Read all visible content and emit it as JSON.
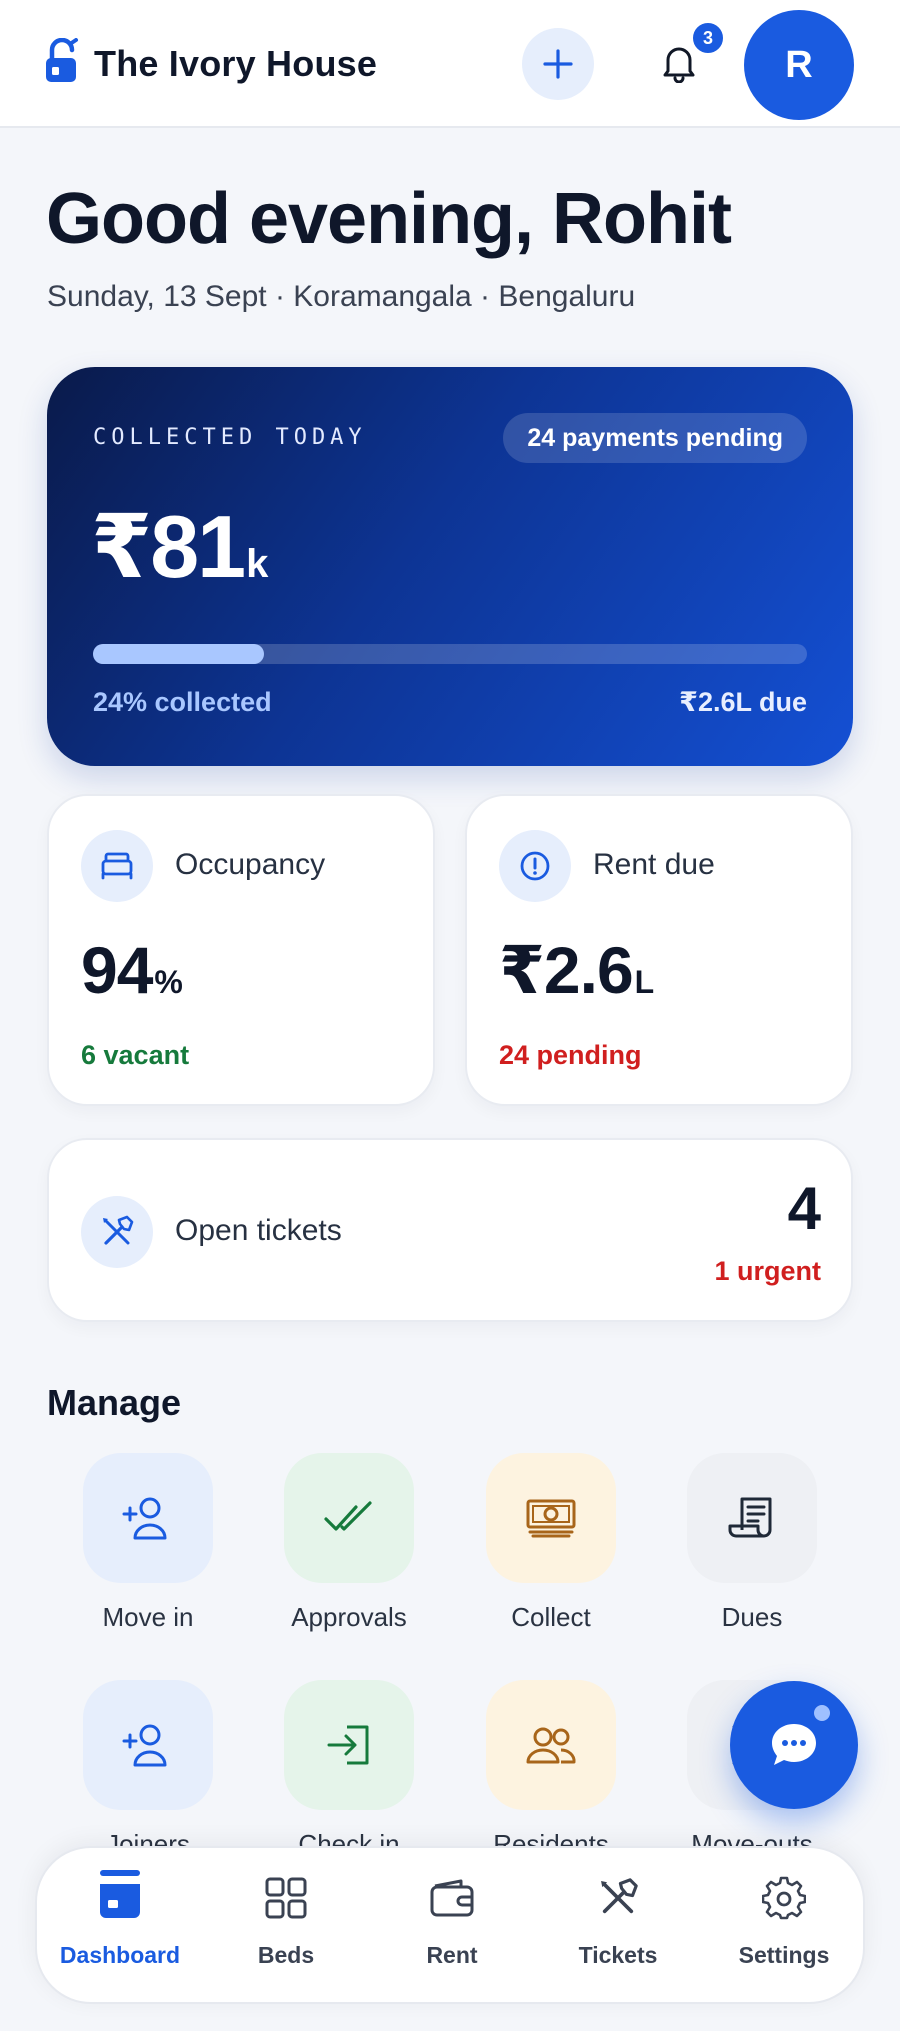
{
  "app": {
    "title": "The Ivory House",
    "notifications_count": "3",
    "avatar_initial": "R"
  },
  "greeting": {
    "title": "Good evening, Rohit",
    "subtitle": "Sunday, 13 Sept · Koramangala · Bengaluru"
  },
  "collected": {
    "label": "COLLECTED TODAY",
    "pending_pill": "24 payments pending",
    "amount": "₹81",
    "amount_unit": "k",
    "progress_fraction": 0.24,
    "percent_text": "24% collected",
    "due_text": "₹2.6L due"
  },
  "occupancy": {
    "title": "Occupancy",
    "value": "94",
    "unit": "%",
    "foot": "6 vacant"
  },
  "rent_due": {
    "title": "Rent due",
    "value": "₹2.6",
    "unit": "L",
    "foot": "24 pending"
  },
  "tickets": {
    "title": "Open tickets",
    "count": "4",
    "urgent": "1 urgent"
  },
  "manage": {
    "title": "Manage",
    "items": [
      {
        "label": "Move in",
        "icon": "user-plus-icon"
      },
      {
        "label": "Approvals",
        "icon": "double-check-icon"
      },
      {
        "label": "Collect",
        "icon": "cash-icon"
      },
      {
        "label": "Dues",
        "icon": "receipt-icon"
      },
      {
        "label": "Joiners",
        "icon": "user-plus-icon"
      },
      {
        "label": "Check in",
        "icon": "sign-in-icon"
      },
      {
        "label": "Residents",
        "icon": "users-icon"
      },
      {
        "label": "Move-outs",
        "icon": "sign-out-icon"
      }
    ]
  },
  "nav": {
    "items": [
      {
        "label": "Dashboard",
        "icon": "calendar-icon",
        "active": true
      },
      {
        "label": "Beds",
        "icon": "grid-icon"
      },
      {
        "label": "Rent",
        "icon": "wallet-icon"
      },
      {
        "label": "Tickets",
        "icon": "tools-icon"
      },
      {
        "label": "Settings",
        "icon": "gear-icon"
      }
    ]
  },
  "colors": {
    "accent": "#1a5be0",
    "success": "#167a3c",
    "danger": "#d01f1f",
    "background": "#f4f6fa"
  }
}
